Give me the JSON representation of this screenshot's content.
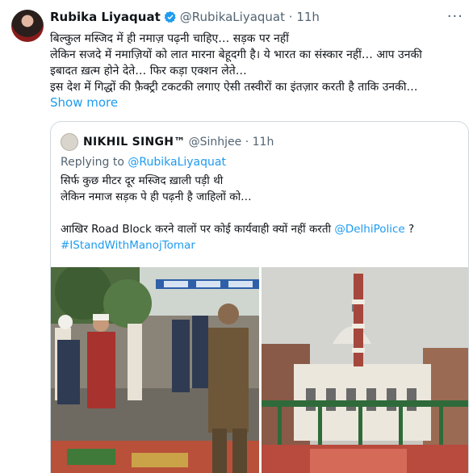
{
  "tweet": {
    "author_name": "Rubika Liyaquat",
    "handle": "@RubikaLiyaquat",
    "time": "11h",
    "lines": [
      "बिल्कुल मस्जिद में ही नमाज़ पढ़नी चाहिए… सड़क पर नहीं",
      "लेकिन सजदे में नमाज़ियों को लात मारना बेहूदगी है। ये भारत का संस्कार नहीं… आप उनकी",
      "इबादत ख़त्म होने देते… फिर कड़ा एक्शन लेते…",
      "इस देश में गिद्धों की फ़ैक्ट्री टकटकी लगाए ऐसी तस्वीरों का इंतज़ार करती है ताकि उनकी…"
    ],
    "show_more": "Show more",
    "more_icon": "more-horizontal-icon",
    "verified_color": "#1d9bf0"
  },
  "quoted": {
    "author_name": "NIKHIL SINGH™",
    "handle": "@Sinhjee",
    "time": "11h",
    "replying_prefix": "Replying to",
    "replying_to": "@RubikaLiyaquat",
    "line1": "सिर्फ कुछ मीटर दूर मस्जिद ख़ाली पड़ी थी",
    "line2": "लेकिन नमाज सड़क पे ही पढ़नी है जाहिलों को…",
    "line3_text": "आखिर Road Block करने वालों पर कोई कार्यवाही क्यों नहीं करती ",
    "line3_mention": "@DelhiPolice",
    "line3_suffix": " ?",
    "hashtag": "#IStandWithManojTomar"
  },
  "colors": {
    "link": "#1d9bf0",
    "muted": "#536471",
    "border": "#cfd9de"
  }
}
